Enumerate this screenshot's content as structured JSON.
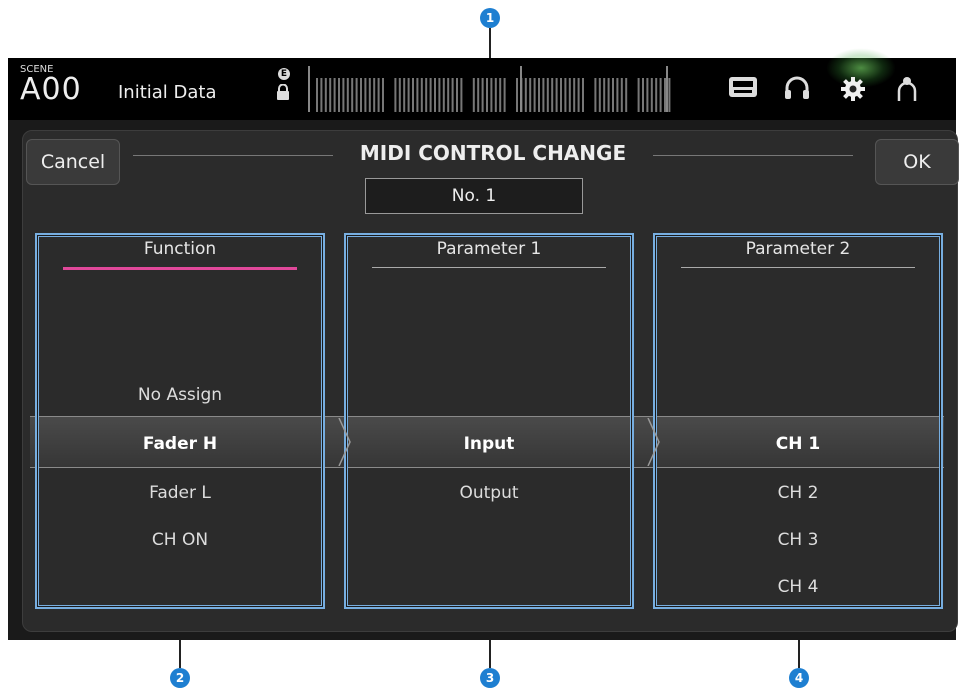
{
  "callouts": [
    "1",
    "2",
    "3",
    "4"
  ],
  "status_bar": {
    "scene_label": "SCENE",
    "scene_number": "A00",
    "scene_title": "Initial Data",
    "edit_badge": "E",
    "icons": [
      "lock-icon",
      "recorder-icon",
      "headphones-icon",
      "gear-icon",
      "user-icon"
    ]
  },
  "dialog": {
    "title": "MIDI CONTROL CHANGE",
    "cancel_label": "Cancel",
    "ok_label": "OK",
    "control_number": "No. 1"
  },
  "columns": [
    {
      "header": "Function",
      "items": [
        "No Assign",
        "Fader H",
        "Fader L",
        "CH ON"
      ],
      "selected": "Fader H"
    },
    {
      "header": "Parameter 1",
      "items": [
        "Input",
        "Output"
      ],
      "selected": "Input"
    },
    {
      "header": "Parameter 2",
      "items": [
        "CH 1",
        "CH 2",
        "CH 3",
        "CH 4"
      ],
      "selected": "CH 1"
    }
  ],
  "colors": {
    "callout": "#1e7fd1",
    "active_underline": "#e0489a",
    "panel_border": "#77aee0"
  }
}
